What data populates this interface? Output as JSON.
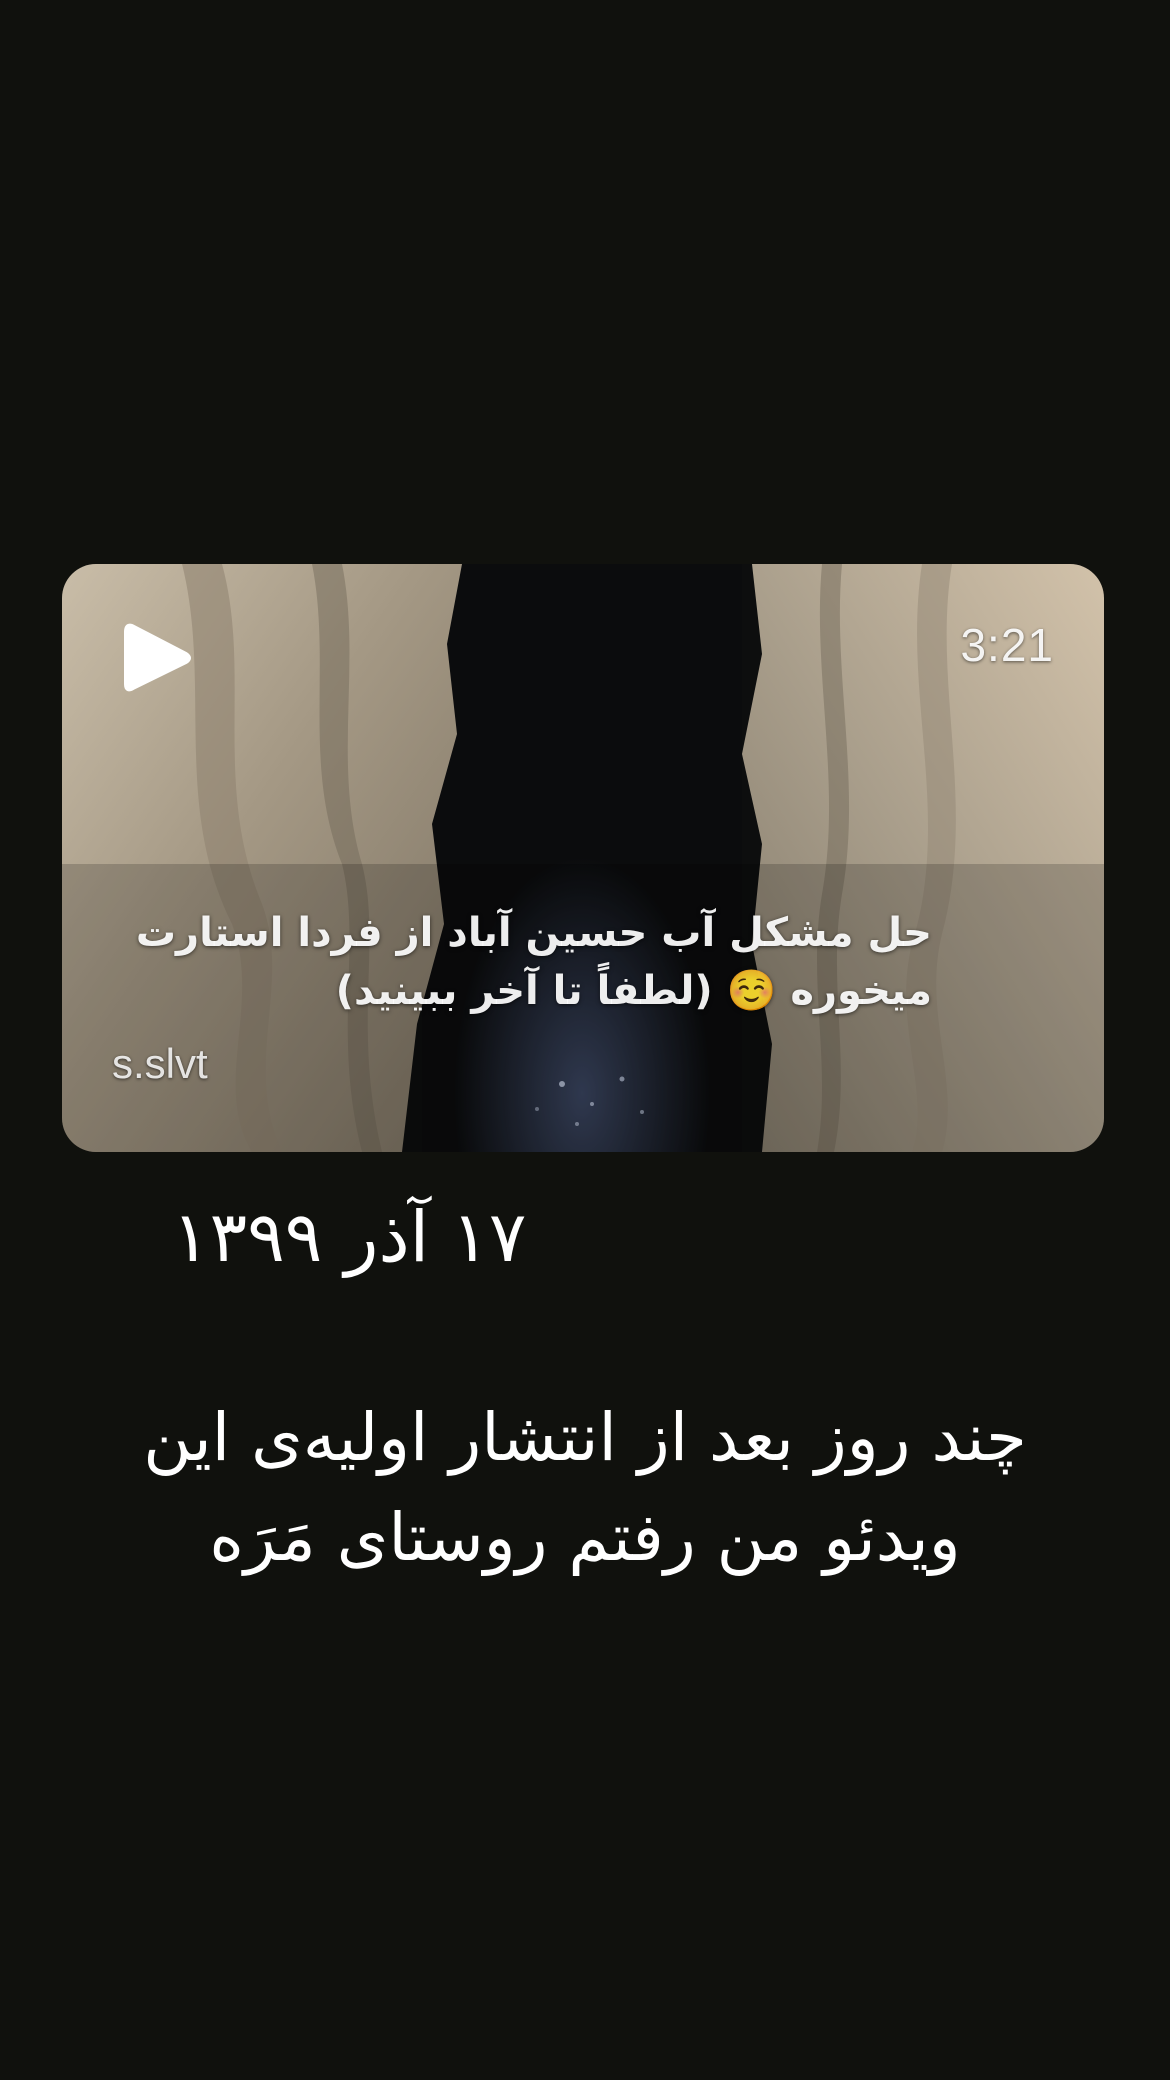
{
  "video": {
    "duration": "3:21",
    "caption": "حل مشکل آب حسین آباد از فردا استارت میخوره ☺️ (لطفاً تا آخر ببینید)",
    "channel": "s.slvt"
  },
  "post": {
    "date": "۱۷ آذر ۱۳۹۹",
    "text": "چند روز بعد از انتشار اولیه‌ی این ویدئو من رفتم روستای مَرَه"
  }
}
